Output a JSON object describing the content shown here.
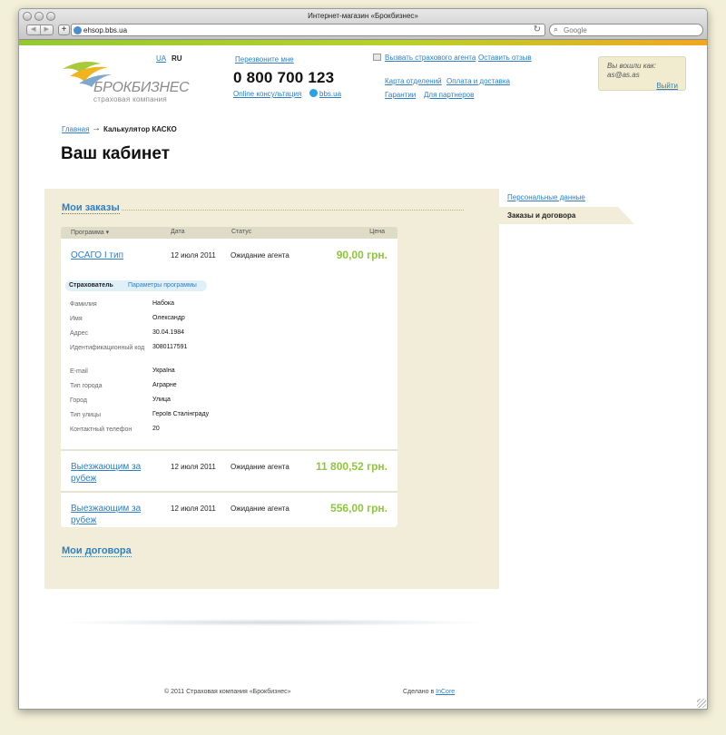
{
  "window": {
    "title": "Интернет-магазин «Брокбизнес»",
    "url": "ehsop.bbs.ua",
    "search_placeholder": "Google",
    "back_label": "◀",
    "forward_label": "▶",
    "add_label": "+",
    "reload_label": "↻",
    "search_icon_label": "⌕"
  },
  "logo": {
    "name": "БРОКБИЗНЕС",
    "subtitle": "страховая компания"
  },
  "header": {
    "lang_ua": "UA",
    "lang_ru": "RU",
    "callback": "Перезвоните мне",
    "phone": "0 800 700 123",
    "online": "Online консультация",
    "skype": "bbs.ua",
    "agent": "Вызвать страхового агента",
    "review": "Оставить отзыв",
    "links": [
      {
        "label": "Карта отделений"
      },
      {
        "label": "Оплата и доставка"
      },
      {
        "label": "Гарантии"
      },
      {
        "label": "Для партнеров"
      }
    ]
  },
  "user": {
    "logged_as": "Вы вошли как:",
    "login": "as@as.as",
    "logout": "Выйти"
  },
  "breadcrumb": {
    "home": "Главная",
    "arrow": "→",
    "current": "Калькулятор КАСКО"
  },
  "page_title": "Ваш кабинет",
  "orders": {
    "title": "Мои заказы",
    "columns": {
      "program": "Программа ▾",
      "date": "Дата",
      "status": "Статус",
      "price": "Цена"
    },
    "items": [
      {
        "name": "ОСАГО І тип",
        "date": "12 июля 2011",
        "status": "Ожидание агента",
        "price": "90,00 грн."
      },
      {
        "name": "Выезжающим за рубеж",
        "date": "12 июля 2011",
        "status": "Ожидание агента",
        "price": "11 800,52 грн."
      },
      {
        "name": "Выезжающим за рубеж",
        "date": "12 июля 2011",
        "status": "Ожидание агента",
        "price": "556,00 грн."
      }
    ],
    "tabs": {
      "insurer": "Страхователь",
      "params": "Параметры программы"
    },
    "details": [
      {
        "label": "Фамилия",
        "value": "Набока"
      },
      {
        "label": "Имя",
        "value": "Олександр"
      },
      {
        "label": "Адрес",
        "value": "30.04.1984"
      },
      {
        "label": "Идентификационный код",
        "value": "3080117591"
      },
      {
        "label": "E-mail",
        "value": "Україна"
      },
      {
        "label": "Тип города",
        "value": "Аграрне"
      },
      {
        "label": "Город",
        "value": "Улица"
      },
      {
        "label": "Тип улицы",
        "value": "Героїв Сталінграду"
      },
      {
        "label": "Контактный телефон",
        "value": "20"
      }
    ]
  },
  "contracts_title": "Мои договора",
  "sidebar": {
    "personal": "Персональные данные",
    "orders": "Заказы и договора"
  },
  "footer": {
    "copyright": "© 2011 Страховая компания «Брокбизнес»",
    "made_prefix": "Сделано в",
    "made_link": "InCore"
  },
  "colors": {
    "accent_link": "#2e7fc4",
    "price_green": "#8ec63f",
    "panel_bg": "#f1edd9",
    "stripe_green": "#93c930",
    "stripe_orange": "#f0a81e"
  }
}
